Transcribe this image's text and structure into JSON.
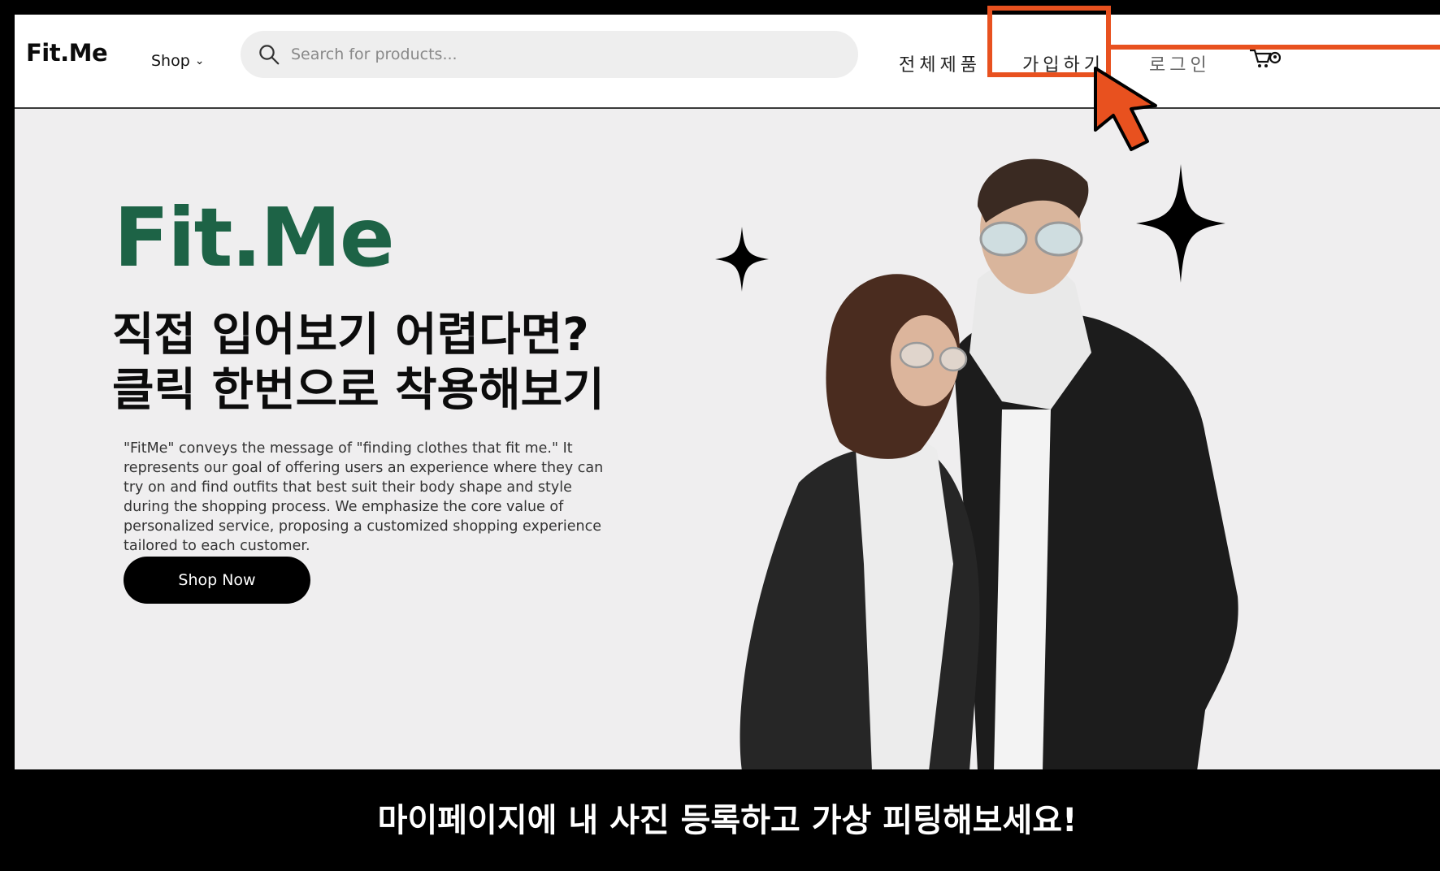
{
  "header": {
    "logo": "Fit.Me",
    "shop_label": "Shop",
    "search_placeholder": "Search for products...",
    "nav": {
      "all_products": "전체제품",
      "signup": "가입하기",
      "login": "로그인"
    }
  },
  "hero": {
    "brand": "Fit.Me",
    "headline_line1": "직접 입어보기 어렵다면?",
    "headline_line2": "클릭 한번으로 착용해보기",
    "description": "\"FitMe\" conveys the message of \"finding clothes that fit me.\" It represents our goal of offering users an experience where they can try on and find outfits that best suit their body shape and style during the shopping process. We emphasize the core value of personalized service, proposing a customized shopping experience tailored to each customer.",
    "cta": "Shop Now"
  },
  "banner": {
    "text": "마이페이지에 내 사진 등록하고 가상 피팅해보세요!"
  },
  "colors": {
    "brand_green": "#1d6346",
    "highlight_orange": "#e8511f",
    "hero_bg": "#efeeef"
  },
  "icons": [
    "search-icon",
    "chevron-down-icon",
    "cart-icon",
    "user-icon",
    "sparkle-icon",
    "cursor-arrow-icon"
  ]
}
